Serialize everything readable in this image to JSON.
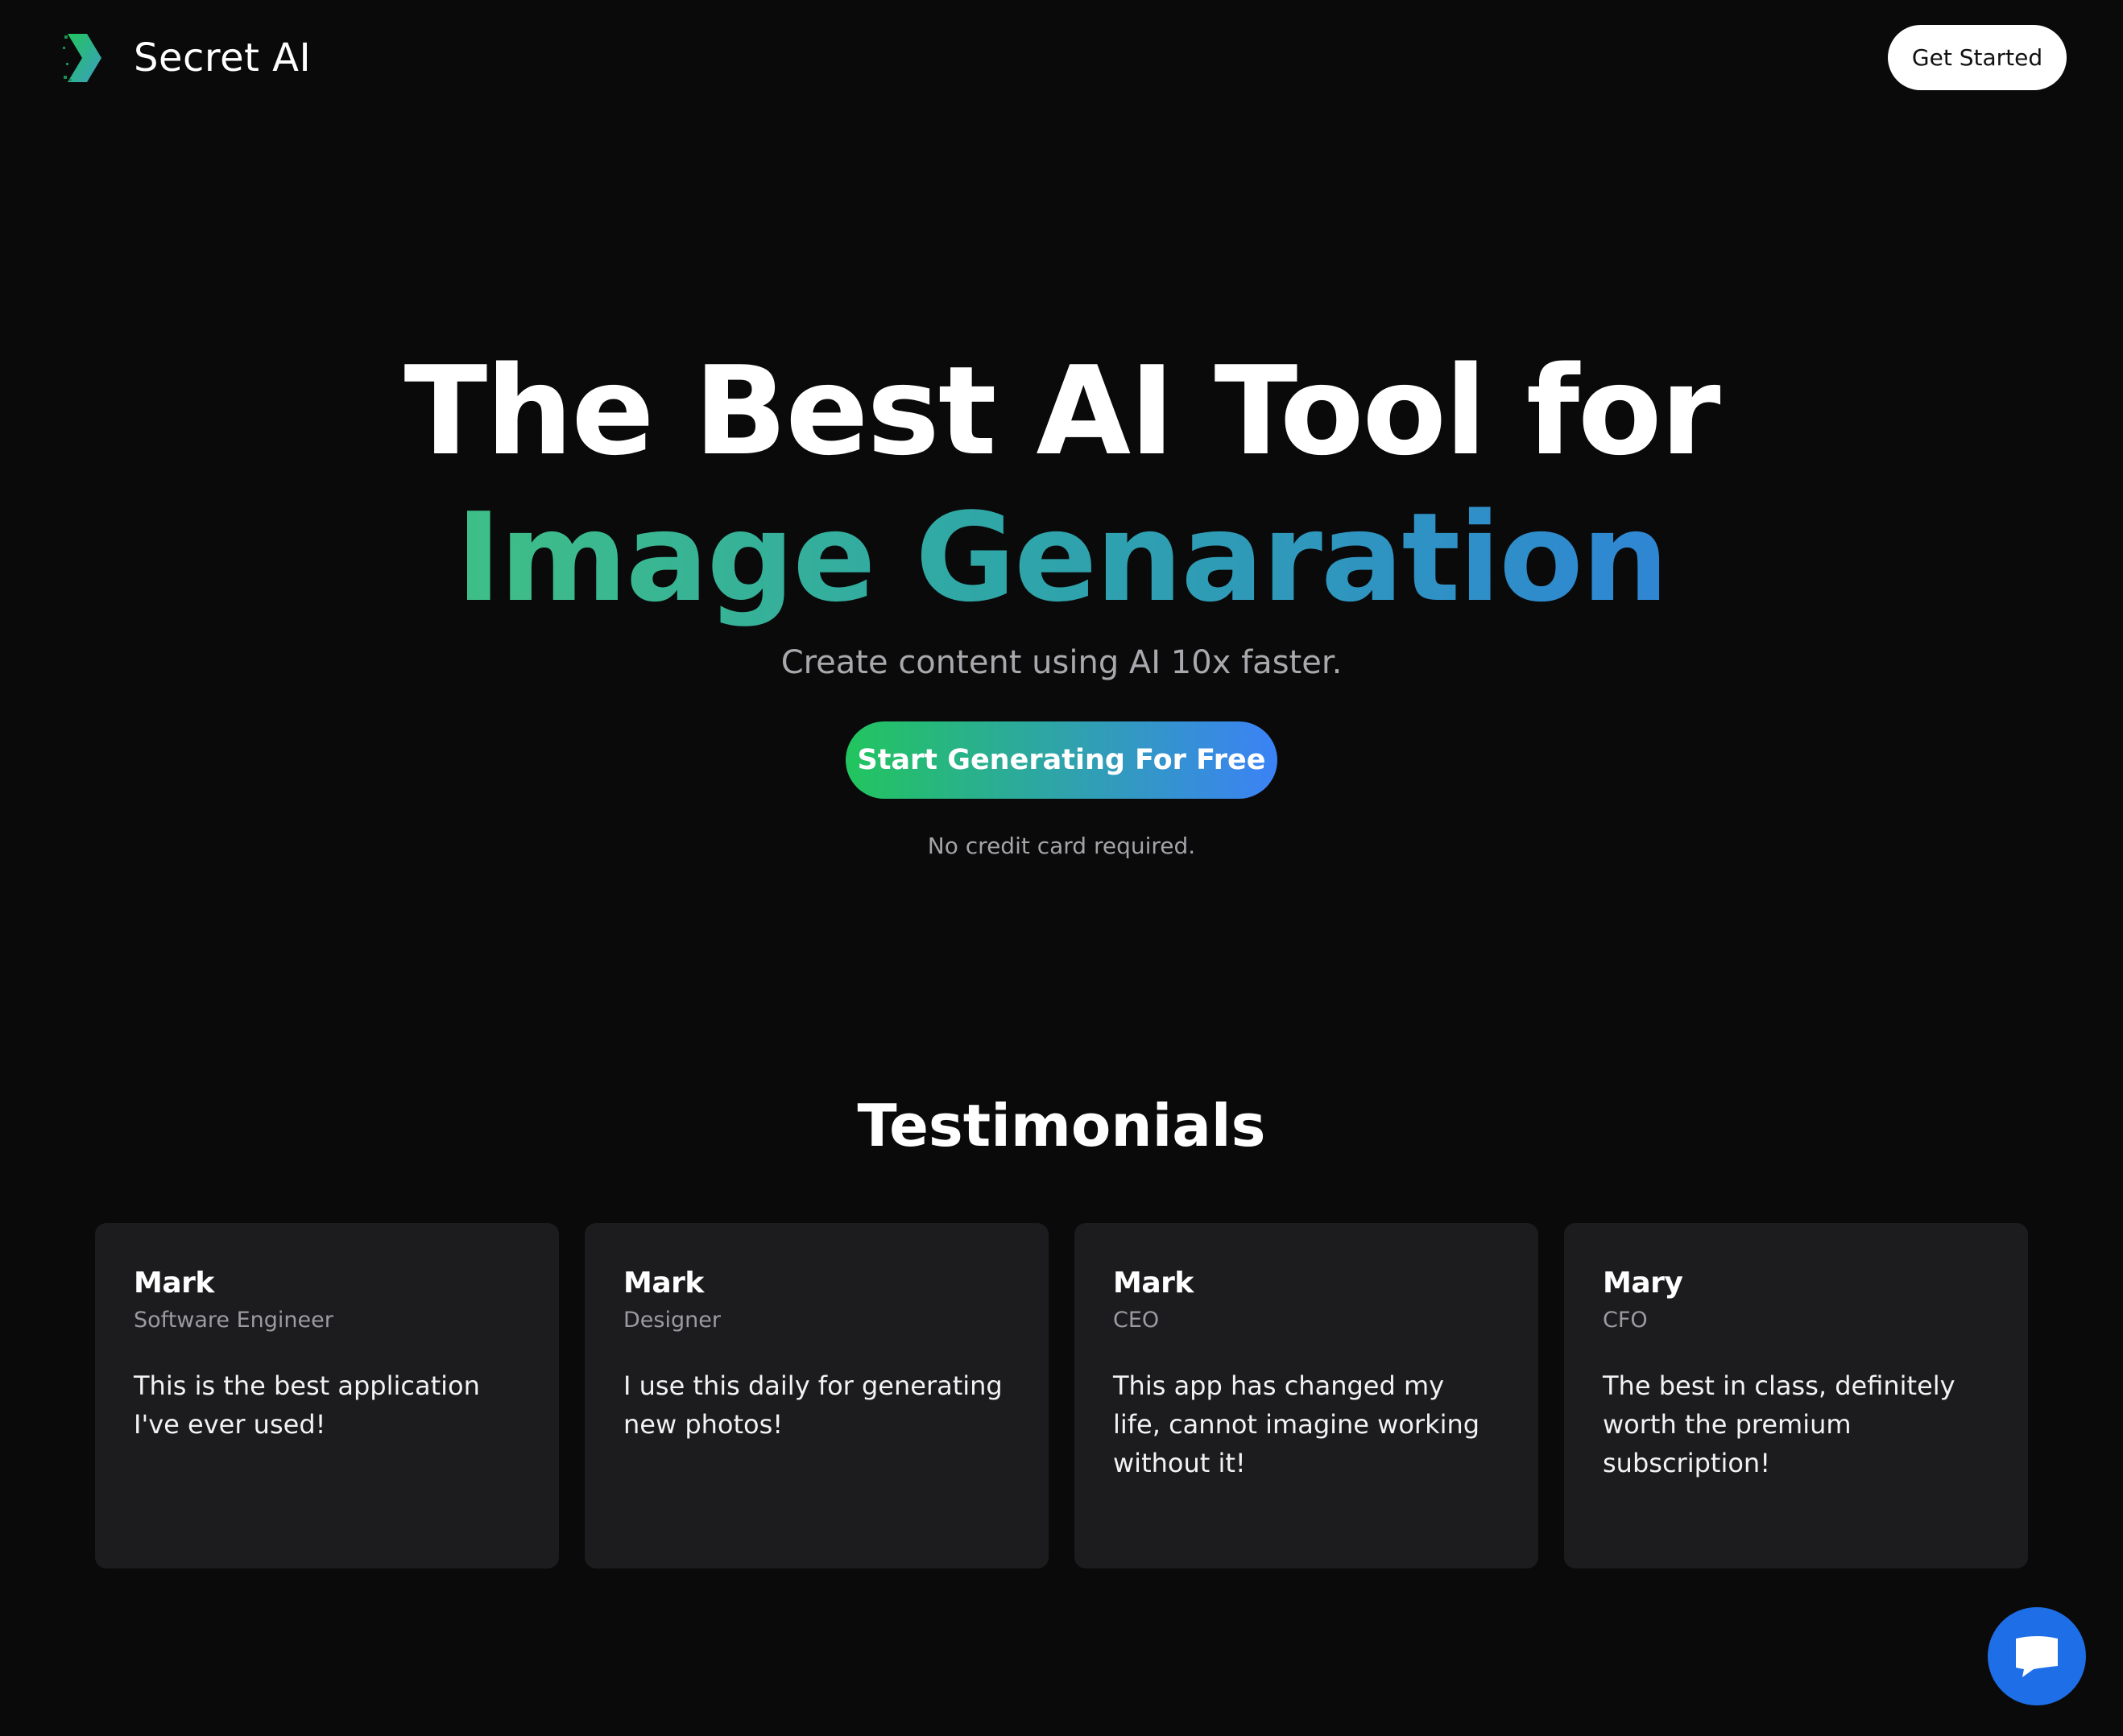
{
  "header": {
    "brand": "Secret AI",
    "cta_label": "Get Started"
  },
  "hero": {
    "title_line1": "The Best AI Tool for",
    "title_line2": "Image Genaration",
    "subtitle": "Create content using AI 10x faster.",
    "cta_label": "Start Generating For Free",
    "note": "No credit card required."
  },
  "testimonials": {
    "title": "Testimonials",
    "items": [
      {
        "name": "Mark",
        "role": "Software Engineer",
        "quote": "This is the best application I've ever used!"
      },
      {
        "name": "Mark",
        "role": "Designer",
        "quote": "I use this daily for generating new photos!"
      },
      {
        "name": "Mark",
        "role": "CEO",
        "quote": "This app has changed my life, cannot imagine working without it!"
      },
      {
        "name": "Mary",
        "role": "CFO",
        "quote": "The best in class, definitely worth the premium subscription!"
      }
    ]
  },
  "chat": {
    "icon": "chat-bubble-icon"
  },
  "colors": {
    "background": "#0a0a0b",
    "card": "#1c1c1e",
    "gradient_start": "#22c55e",
    "gradient_end": "#3b82f6",
    "chat_button": "#1e6ee8"
  }
}
